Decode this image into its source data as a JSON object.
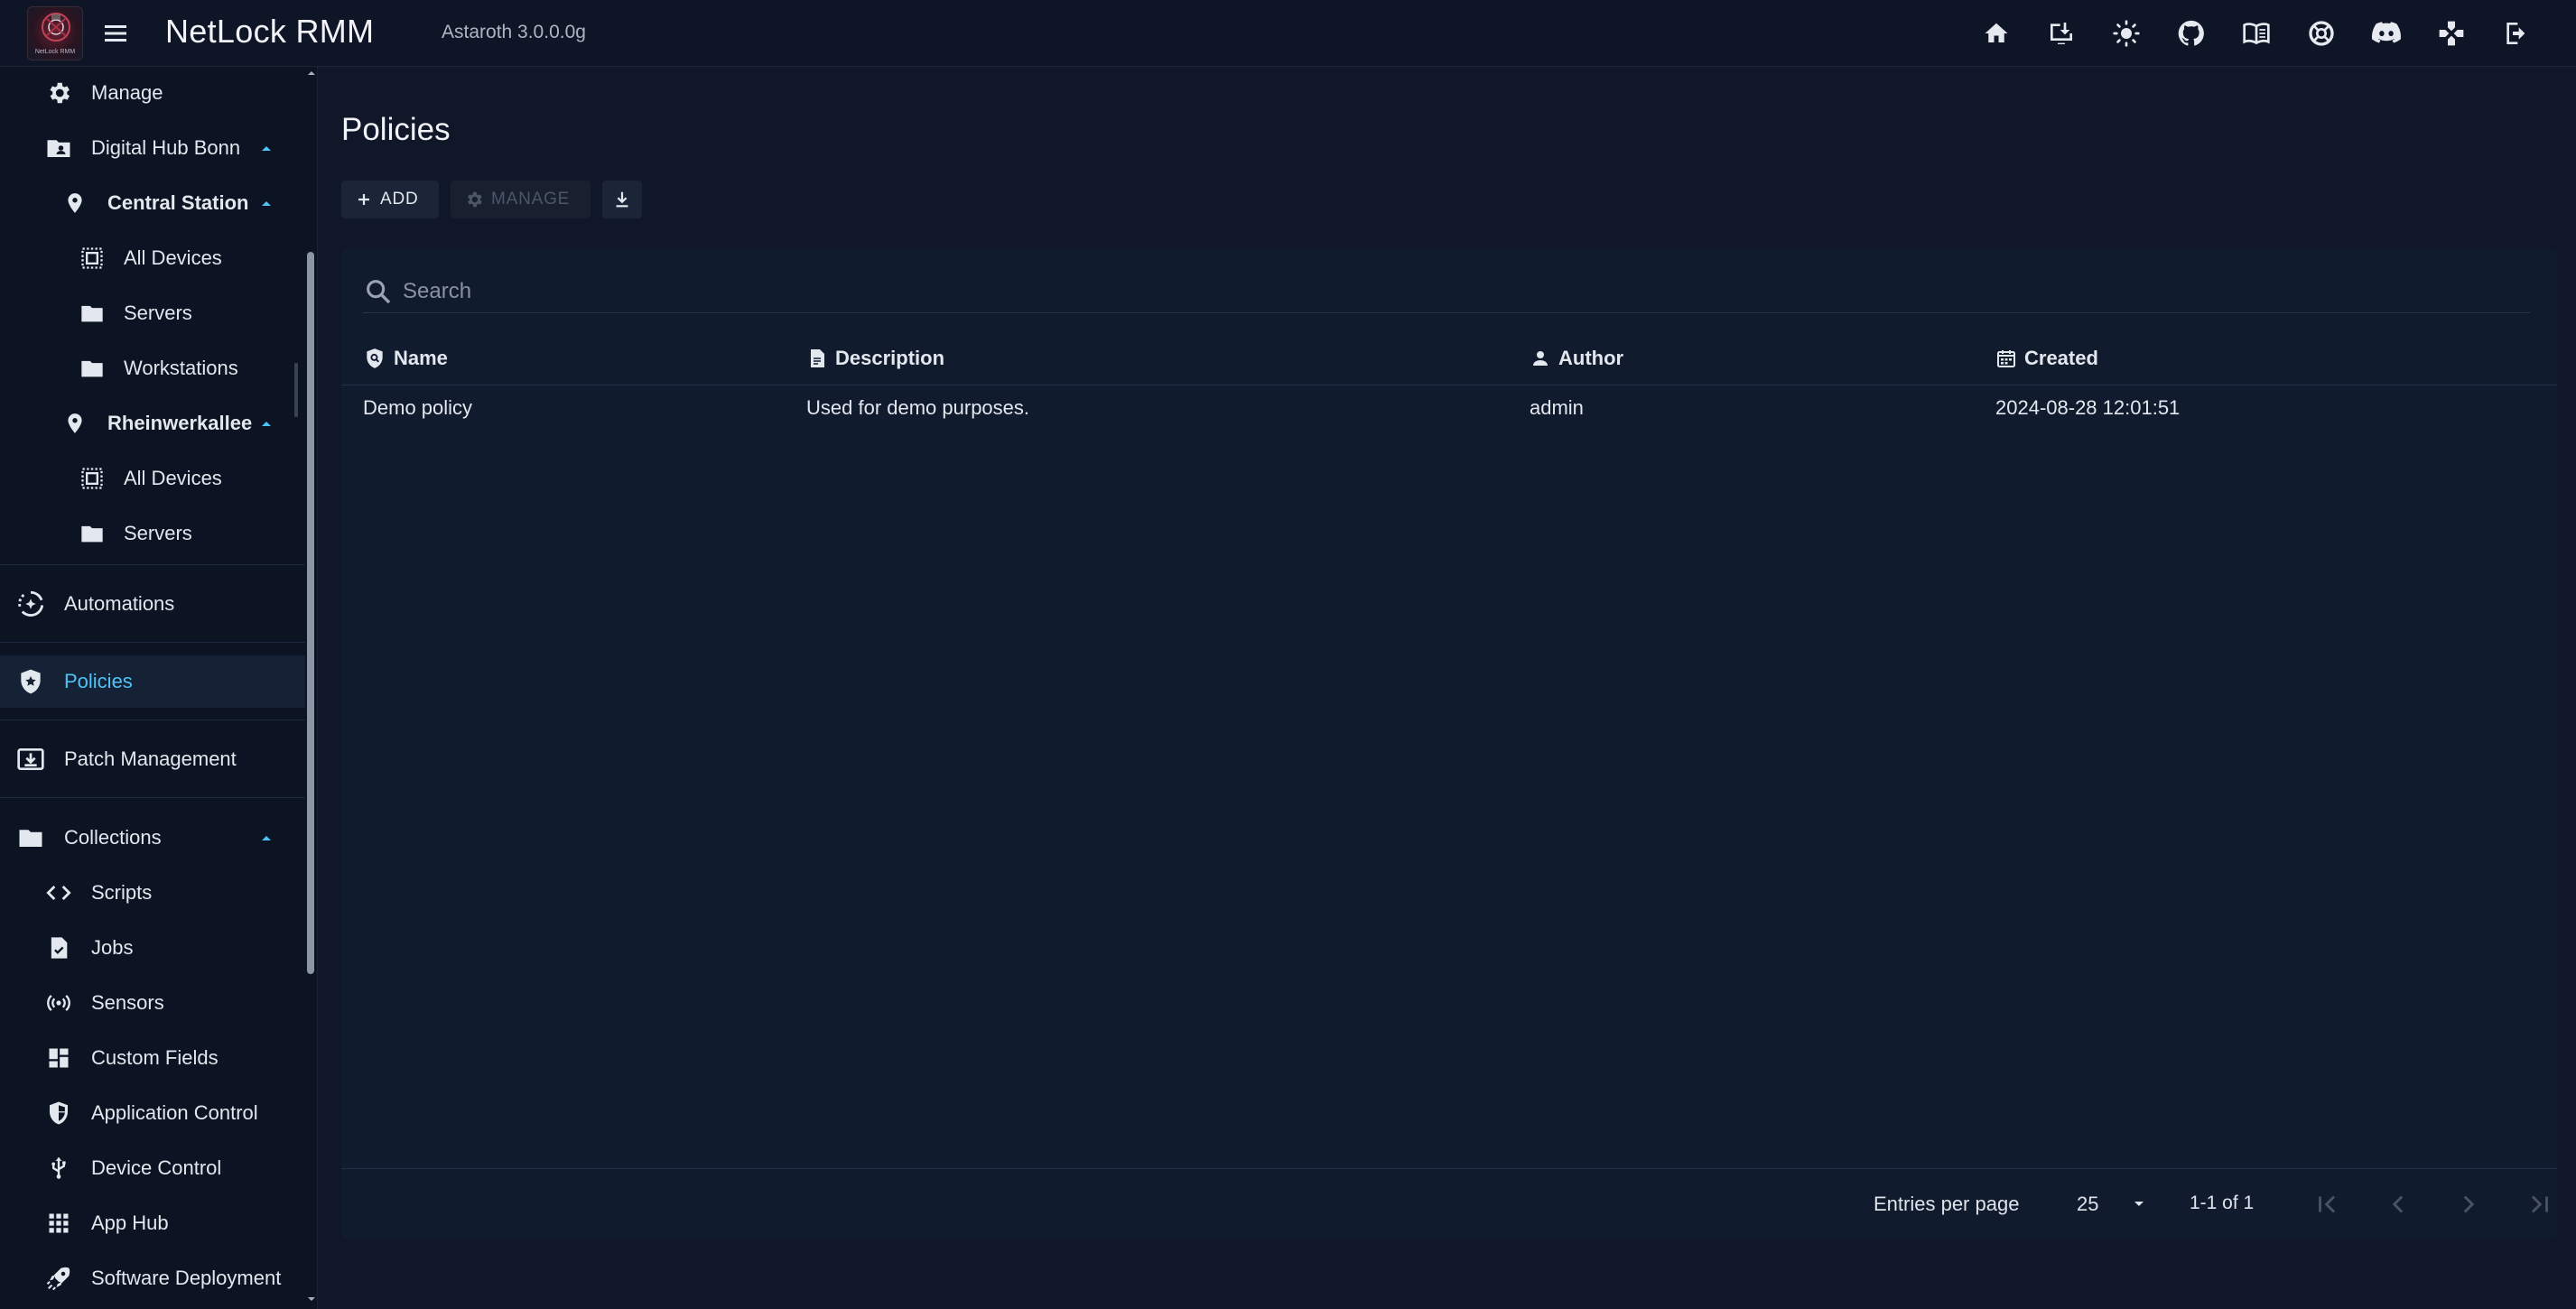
{
  "app": {
    "title": "NetLock RMM",
    "version": "Astaroth 3.0.0.0g",
    "logo_text": "NetLock RMM"
  },
  "topbar_icons": [
    "home-icon",
    "download-icon",
    "theme-icon",
    "github-icon",
    "docs-icon",
    "support-icon",
    "discord-icon",
    "game-icon",
    "logout-icon"
  ],
  "sidebar": {
    "items": [
      {
        "label": "Manage",
        "icon": "gear-icon"
      },
      {
        "label": "Digital Hub Bonn",
        "icon": "folder-account-icon"
      },
      {
        "label": "Central Station",
        "icon": "location-icon"
      },
      {
        "label": "All Devices",
        "icon": "devices-icon"
      },
      {
        "label": "Servers",
        "icon": "folder-icon"
      },
      {
        "label": "Workstations",
        "icon": "folder-icon"
      },
      {
        "label": "Rheinwerkallee",
        "icon": "location-icon"
      },
      {
        "label": "All Devices",
        "icon": "devices-icon"
      },
      {
        "label": "Servers",
        "icon": "folder-icon"
      },
      {
        "label": "Automations",
        "icon": "automation-icon"
      },
      {
        "label": "Policies",
        "icon": "shield-star-icon"
      },
      {
        "label": "Patch Management",
        "icon": "patch-icon"
      },
      {
        "label": "Collections",
        "icon": "folder-icon"
      },
      {
        "label": "Scripts",
        "icon": "code-icon"
      },
      {
        "label": "Jobs",
        "icon": "job-icon"
      },
      {
        "label": "Sensors",
        "icon": "sensor-icon"
      },
      {
        "label": "Custom Fields",
        "icon": "dashboard-icon"
      },
      {
        "label": "Application Control",
        "icon": "shield-half-icon"
      },
      {
        "label": "Device Control",
        "icon": "usb-icon"
      },
      {
        "label": "App Hub",
        "icon": "apps-icon"
      },
      {
        "label": "Software Deployment",
        "icon": "rocket-icon"
      }
    ]
  },
  "page": {
    "title": "Policies",
    "actions": {
      "add": "ADD",
      "manage": "MANAGE"
    }
  },
  "table": {
    "search_placeholder": "Search",
    "columns": [
      "Name",
      "Description",
      "Author",
      "Created"
    ],
    "rows": [
      {
        "name": "Demo policy",
        "description": "Used for demo purposes.",
        "author": "admin",
        "created": "2024-08-28 12:01:51"
      }
    ]
  },
  "pagination": {
    "entries_label": "Entries per page",
    "per_page": "25",
    "range": "1-1 of 1"
  },
  "colors": {
    "background": "#0f1728",
    "panel": "#111b2e",
    "accent": "#4fc3f7"
  }
}
